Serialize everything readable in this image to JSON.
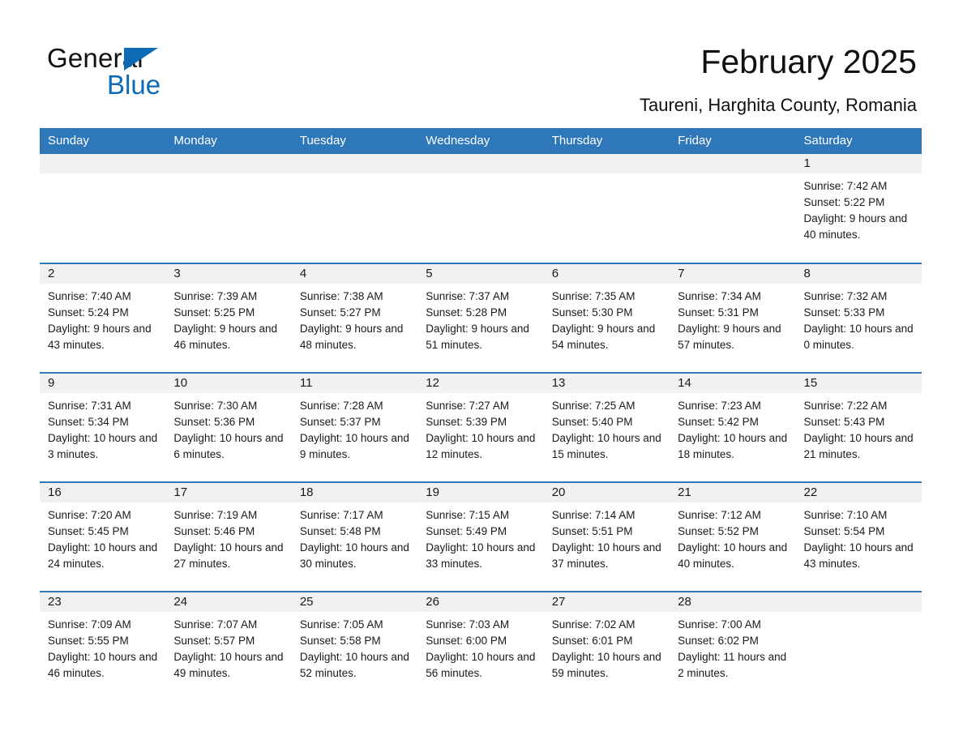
{
  "brand": {
    "name_part1": "General",
    "name_part2": "Blue",
    "triangle_color": "#0d6ab5"
  },
  "header": {
    "title": "February 2025",
    "subtitle": "Taureni, Harghita County, Romania"
  },
  "theme": {
    "header_blue": "#2e77b8",
    "daynum_band": "#f1f1f1",
    "text": "#1a1a1a"
  },
  "weekday_headers": [
    "Sunday",
    "Monday",
    "Tuesday",
    "Wednesday",
    "Thursday",
    "Friday",
    "Saturday"
  ],
  "labels": {
    "sunrise_prefix": "Sunrise: ",
    "sunset_prefix": "Sunset: ",
    "daylight_prefix": "Daylight: "
  },
  "weeks": [
    [
      {
        "day": "",
        "sunrise": "",
        "sunset": "",
        "daylight": "",
        "empty": true
      },
      {
        "day": "",
        "sunrise": "",
        "sunset": "",
        "daylight": "",
        "empty": true
      },
      {
        "day": "",
        "sunrise": "",
        "sunset": "",
        "daylight": "",
        "empty": true
      },
      {
        "day": "",
        "sunrise": "",
        "sunset": "",
        "daylight": "",
        "empty": true
      },
      {
        "day": "",
        "sunrise": "",
        "sunset": "",
        "daylight": "",
        "empty": true
      },
      {
        "day": "",
        "sunrise": "",
        "sunset": "",
        "daylight": "",
        "empty": true
      },
      {
        "day": "1",
        "sunrise": "Sunrise: 7:42 AM",
        "sunset": "Sunset: 5:22 PM",
        "daylight": "Daylight: 9 hours and 40 minutes.",
        "empty": false
      }
    ],
    [
      {
        "day": "2",
        "sunrise": "Sunrise: 7:40 AM",
        "sunset": "Sunset: 5:24 PM",
        "daylight": "Daylight: 9 hours and 43 minutes.",
        "empty": false
      },
      {
        "day": "3",
        "sunrise": "Sunrise: 7:39 AM",
        "sunset": "Sunset: 5:25 PM",
        "daylight": "Daylight: 9 hours and 46 minutes.",
        "empty": false
      },
      {
        "day": "4",
        "sunrise": "Sunrise: 7:38 AM",
        "sunset": "Sunset: 5:27 PM",
        "daylight": "Daylight: 9 hours and 48 minutes.",
        "empty": false
      },
      {
        "day": "5",
        "sunrise": "Sunrise: 7:37 AM",
        "sunset": "Sunset: 5:28 PM",
        "daylight": "Daylight: 9 hours and 51 minutes.",
        "empty": false
      },
      {
        "day": "6",
        "sunrise": "Sunrise: 7:35 AM",
        "sunset": "Sunset: 5:30 PM",
        "daylight": "Daylight: 9 hours and 54 minutes.",
        "empty": false
      },
      {
        "day": "7",
        "sunrise": "Sunrise: 7:34 AM",
        "sunset": "Sunset: 5:31 PM",
        "daylight": "Daylight: 9 hours and 57 minutes.",
        "empty": false
      },
      {
        "day": "8",
        "sunrise": "Sunrise: 7:32 AM",
        "sunset": "Sunset: 5:33 PM",
        "daylight": "Daylight: 10 hours and 0 minutes.",
        "empty": false
      }
    ],
    [
      {
        "day": "9",
        "sunrise": "Sunrise: 7:31 AM",
        "sunset": "Sunset: 5:34 PM",
        "daylight": "Daylight: 10 hours and 3 minutes.",
        "empty": false
      },
      {
        "day": "10",
        "sunrise": "Sunrise: 7:30 AM",
        "sunset": "Sunset: 5:36 PM",
        "daylight": "Daylight: 10 hours and 6 minutes.",
        "empty": false
      },
      {
        "day": "11",
        "sunrise": "Sunrise: 7:28 AM",
        "sunset": "Sunset: 5:37 PM",
        "daylight": "Daylight: 10 hours and 9 minutes.",
        "empty": false
      },
      {
        "day": "12",
        "sunrise": "Sunrise: 7:27 AM",
        "sunset": "Sunset: 5:39 PM",
        "daylight": "Daylight: 10 hours and 12 minutes.",
        "empty": false
      },
      {
        "day": "13",
        "sunrise": "Sunrise: 7:25 AM",
        "sunset": "Sunset: 5:40 PM",
        "daylight": "Daylight: 10 hours and 15 minutes.",
        "empty": false
      },
      {
        "day": "14",
        "sunrise": "Sunrise: 7:23 AM",
        "sunset": "Sunset: 5:42 PM",
        "daylight": "Daylight: 10 hours and 18 minutes.",
        "empty": false
      },
      {
        "day": "15",
        "sunrise": "Sunrise: 7:22 AM",
        "sunset": "Sunset: 5:43 PM",
        "daylight": "Daylight: 10 hours and 21 minutes.",
        "empty": false
      }
    ],
    [
      {
        "day": "16",
        "sunrise": "Sunrise: 7:20 AM",
        "sunset": "Sunset: 5:45 PM",
        "daylight": "Daylight: 10 hours and 24 minutes.",
        "empty": false
      },
      {
        "day": "17",
        "sunrise": "Sunrise: 7:19 AM",
        "sunset": "Sunset: 5:46 PM",
        "daylight": "Daylight: 10 hours and 27 minutes.",
        "empty": false
      },
      {
        "day": "18",
        "sunrise": "Sunrise: 7:17 AM",
        "sunset": "Sunset: 5:48 PM",
        "daylight": "Daylight: 10 hours and 30 minutes.",
        "empty": false
      },
      {
        "day": "19",
        "sunrise": "Sunrise: 7:15 AM",
        "sunset": "Sunset: 5:49 PM",
        "daylight": "Daylight: 10 hours and 33 minutes.",
        "empty": false
      },
      {
        "day": "20",
        "sunrise": "Sunrise: 7:14 AM",
        "sunset": "Sunset: 5:51 PM",
        "daylight": "Daylight: 10 hours and 37 minutes.",
        "empty": false
      },
      {
        "day": "21",
        "sunrise": "Sunrise: 7:12 AM",
        "sunset": "Sunset: 5:52 PM",
        "daylight": "Daylight: 10 hours and 40 minutes.",
        "empty": false
      },
      {
        "day": "22",
        "sunrise": "Sunrise: 7:10 AM",
        "sunset": "Sunset: 5:54 PM",
        "daylight": "Daylight: 10 hours and 43 minutes.",
        "empty": false
      }
    ],
    [
      {
        "day": "23",
        "sunrise": "Sunrise: 7:09 AM",
        "sunset": "Sunset: 5:55 PM",
        "daylight": "Daylight: 10 hours and 46 minutes.",
        "empty": false
      },
      {
        "day": "24",
        "sunrise": "Sunrise: 7:07 AM",
        "sunset": "Sunset: 5:57 PM",
        "daylight": "Daylight: 10 hours and 49 minutes.",
        "empty": false
      },
      {
        "day": "25",
        "sunrise": "Sunrise: 7:05 AM",
        "sunset": "Sunset: 5:58 PM",
        "daylight": "Daylight: 10 hours and 52 minutes.",
        "empty": false
      },
      {
        "day": "26",
        "sunrise": "Sunrise: 7:03 AM",
        "sunset": "Sunset: 6:00 PM",
        "daylight": "Daylight: 10 hours and 56 minutes.",
        "empty": false
      },
      {
        "day": "27",
        "sunrise": "Sunrise: 7:02 AM",
        "sunset": "Sunset: 6:01 PM",
        "daylight": "Daylight: 10 hours and 59 minutes.",
        "empty": false
      },
      {
        "day": "28",
        "sunrise": "Sunrise: 7:00 AM",
        "sunset": "Sunset: 6:02 PM",
        "daylight": "Daylight: 11 hours and 2 minutes.",
        "empty": false
      },
      {
        "day": "",
        "sunrise": "",
        "sunset": "",
        "daylight": "",
        "empty": true
      }
    ]
  ]
}
